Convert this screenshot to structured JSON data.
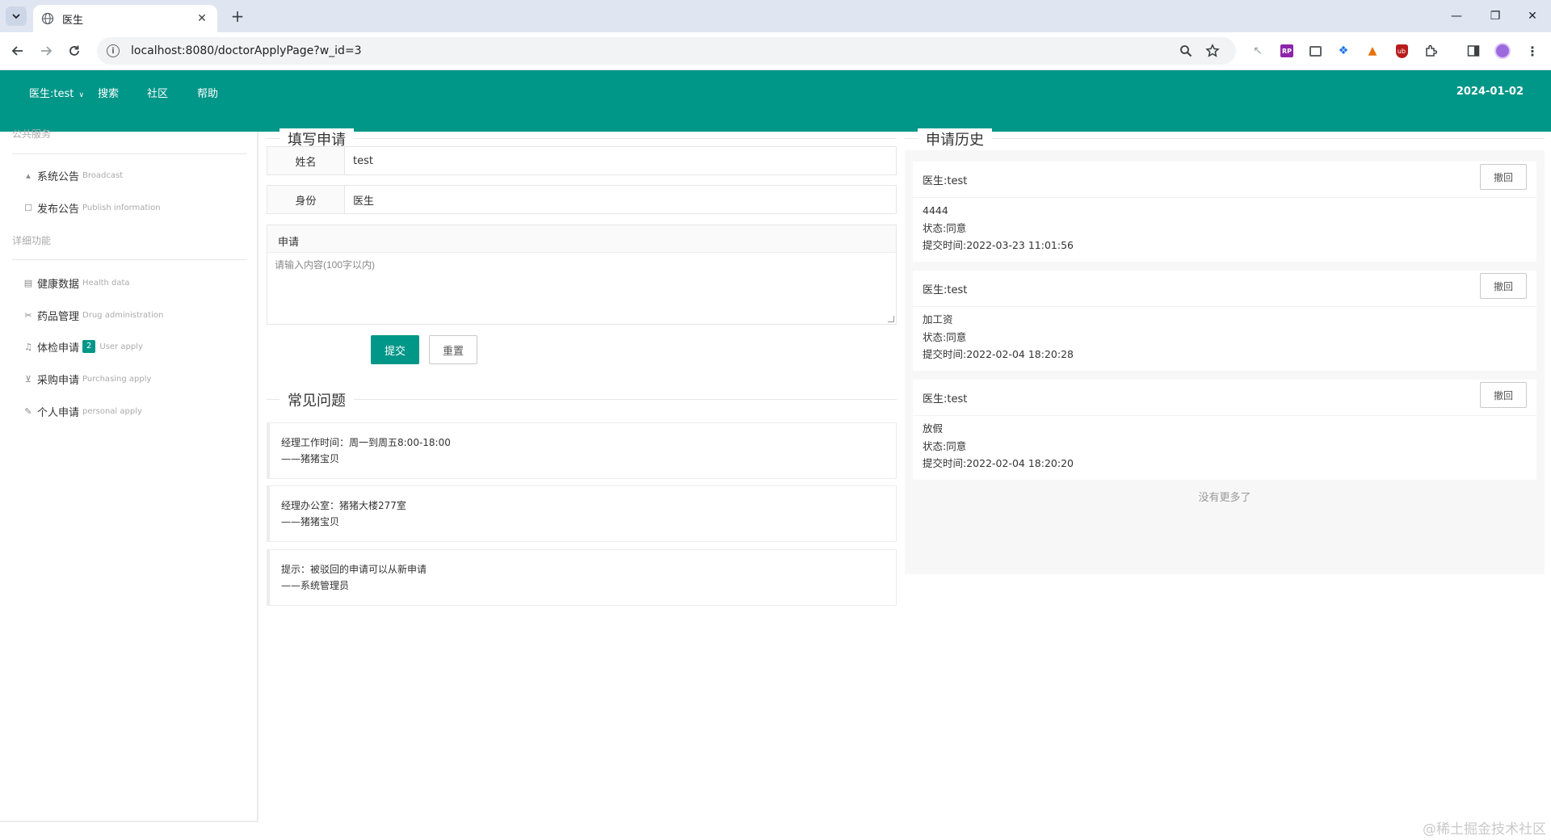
{
  "browser": {
    "tab_title": "医生",
    "url": "localhost:8080/doctorApplyPage?w_id=3"
  },
  "header": {
    "user_menu": "医生:test",
    "nav": [
      "搜索",
      "社区",
      "帮助"
    ],
    "date": "2024-01-02"
  },
  "sidebar": {
    "group1": "公共服务",
    "group1_items": [
      {
        "label": "系统公告",
        "en": "Broadcast",
        "icon": "broadcast-icon"
      },
      {
        "label": "发布公告",
        "en": "Publish information",
        "icon": "publish-icon"
      }
    ],
    "group2": "详细功能",
    "group2_items": [
      {
        "label": "健康数据",
        "en": "Health data",
        "icon": "health-icon"
      },
      {
        "label": "药品管理",
        "en": "Drug administration",
        "icon": "drug-icon"
      },
      {
        "label": "体检申请",
        "en": "User apply",
        "icon": "bell-icon",
        "badge": "2"
      },
      {
        "label": "采购申请",
        "en": "Purchasing apply",
        "icon": "cart-icon"
      },
      {
        "label": "个人申请",
        "en": "personal apply",
        "icon": "pencil-icon"
      }
    ]
  },
  "form": {
    "title": "填写申请",
    "name_label": "姓名",
    "name_value": "test",
    "identity_label": "身份",
    "identity_value": "医生",
    "apply_label": "申请",
    "apply_placeholder": "请输入内容(100字以内)",
    "submit": "提交",
    "reset": "重置"
  },
  "faq": {
    "title": "常见问题",
    "items": [
      {
        "line1": "经理工作时间：周一到周五8:00-18:00",
        "line2": "——猪猪宝贝"
      },
      {
        "line1": "经理办公室：猪猪大楼277室",
        "line2": "——猪猪宝贝"
      },
      {
        "line1": "提示：被驳回的申请可以从新申请",
        "line2": "——系统管理员"
      }
    ]
  },
  "history": {
    "title": "申请历史",
    "items": [
      {
        "head": "医生:test",
        "content": "4444",
        "status": "状态:同意",
        "time": "提交时间:2022-03-23 11:01:56",
        "action": "撤回"
      },
      {
        "head": "医生:test",
        "content": "加工资",
        "status": "状态:同意",
        "time": "提交时间:2022-02-04 18:20:28",
        "action": "撤回"
      },
      {
        "head": "医生:test",
        "content": "放假",
        "status": "状态:同意",
        "time": "提交时间:2022-02-04 18:20:20",
        "action": "撤回"
      }
    ],
    "no_more": "没有更多了"
  },
  "watermark": "@稀土掘金技术社区",
  "colors": {
    "primary": "#009688",
    "browser_frame": "#dfe6f2"
  }
}
